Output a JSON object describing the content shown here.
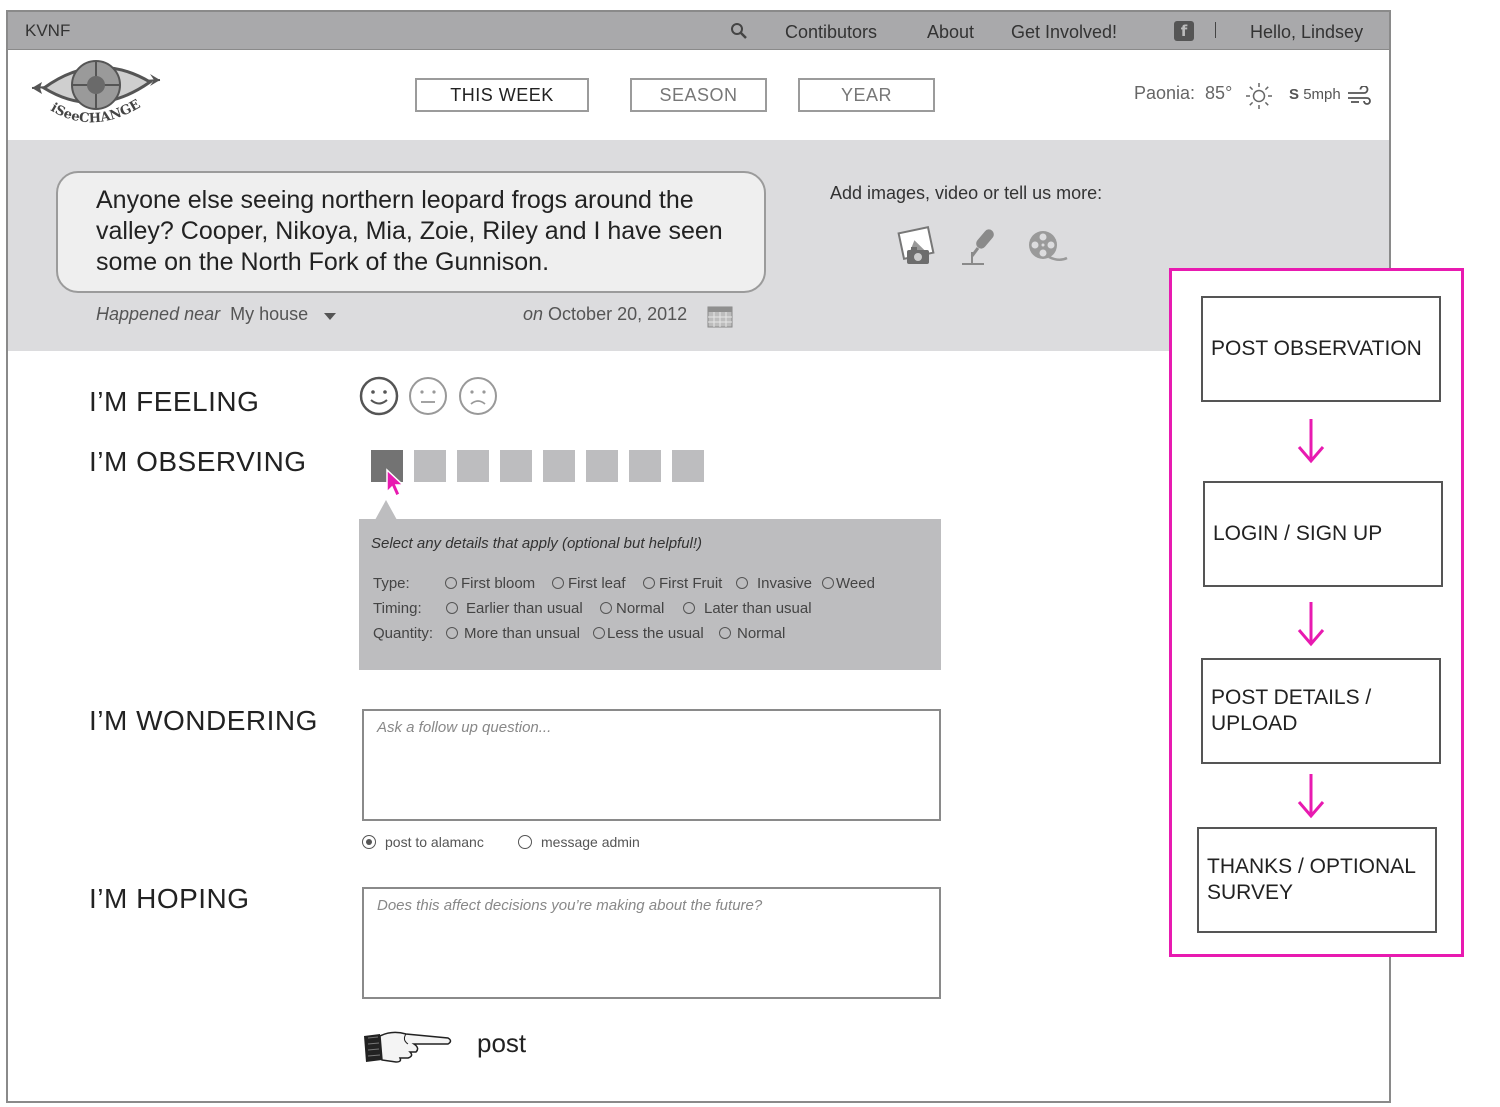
{
  "topbar": {
    "brand": "KVNF",
    "nav": [
      "Contibutors",
      "About",
      "Get Involved!"
    ],
    "facebook_glyph": "f",
    "greeting": "Hello, Lindsey",
    "icons": [
      "search-icon",
      "facebook-icon"
    ]
  },
  "header": {
    "logo_text": "iSeeCHANGE",
    "tabs": [
      "THIS WEEK",
      "SEASON",
      "YEAR"
    ],
    "selected_tab": "THIS WEEK",
    "weather": {
      "city_temp": "Paonia:  85°",
      "wind_dir": "S",
      "wind_speed": "5mph",
      "icons": [
        "sun-icon",
        "wind-icon"
      ]
    }
  },
  "post": {
    "text": "Anyone else seeing northern leopard frogs around the valley? Cooper, Nikoya, Mia, Zoie, Riley and I have seen some on the North Fork of the Gunnison.",
    "happened_near_label": "Happened near",
    "location": "My house",
    "on_label": "on",
    "date": "October 20, 2012",
    "add_media_label": "Add images, video or tell us more:",
    "media_icons": [
      "camera-icon",
      "microphone-icon",
      "film-reel-icon"
    ]
  },
  "form": {
    "feeling_label": "I’M FEELING",
    "feeling_options": [
      "happy-face-icon",
      "neutral-face-icon",
      "sad-face-icon"
    ],
    "observing_label": "I’M OBSERVING",
    "observing_selected_index": 0,
    "observing_count": 8,
    "details": {
      "intro": "Select any details that apply (optional but helpful!)",
      "type_label": "Type:",
      "type_options": [
        "First bloom",
        "First leaf",
        "First Fruit",
        "Invasive",
        "Weed"
      ],
      "timing_label": "Timing:",
      "timing_options": [
        "Earlier than usual",
        "Normal",
        "Later than usual"
      ],
      "quantity_label": "Quantity:",
      "quantity_options": [
        "More than unsual",
        "Less the usual",
        "Normal"
      ]
    },
    "wondering_label": "I’M WONDERING",
    "wondering_placeholder": "Ask a follow up question...",
    "post_to_almanac": "post to alamanc",
    "message_admin": "message admin",
    "selected_destination": "post to alamanc",
    "hoping_label": "I’M HOPING",
    "hoping_placeholder": "Does this affect decisions you’re making about the future?",
    "post_label": "post"
  },
  "flow": {
    "steps": [
      "POST OBSERVATION",
      "LOGIN / SIGN UP",
      "POST DETAILS / UPLOAD",
      "THANKS / OPTIONAL SURVEY"
    ],
    "accent_color": "#e81ab0"
  },
  "colors": {
    "topbar": "#a9a9ab",
    "panel": "#dcdcde",
    "accent": "#e81ab0"
  }
}
